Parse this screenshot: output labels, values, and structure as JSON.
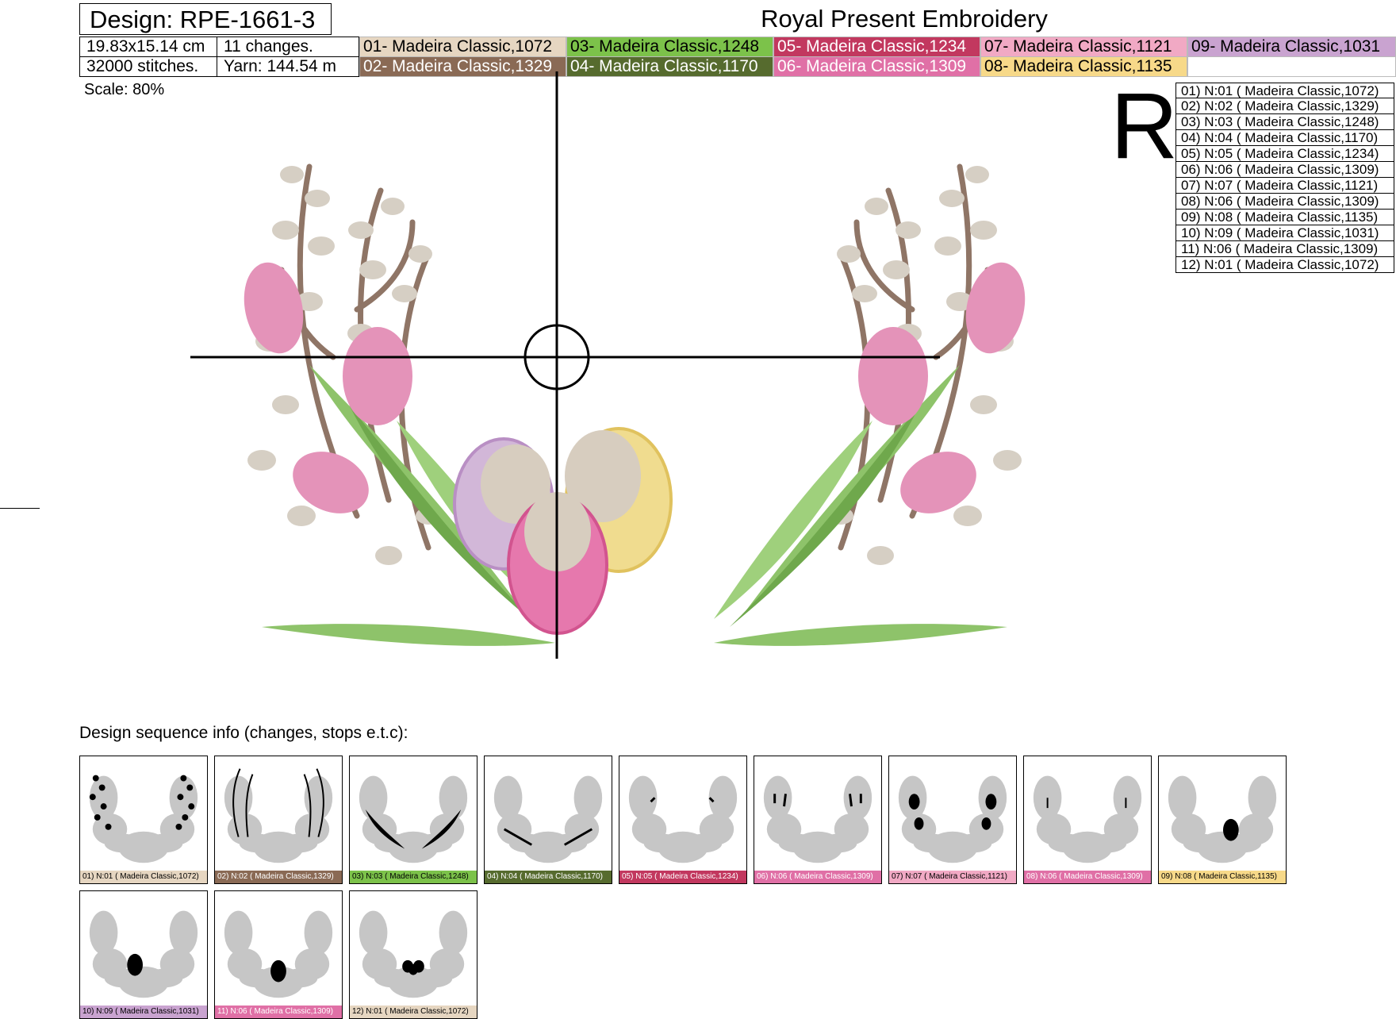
{
  "design_label": "Design: RPE-1661-3",
  "brand": "Royal Present Embroidery",
  "info": {
    "size": "19.83x15.14 cm",
    "changes": "11 changes.",
    "stitches": "32000 stitches.",
    "yarn": "Yarn: 144.54 m"
  },
  "threads": [
    {
      "label": "01- Madeira Classic,1072",
      "color": "#e6d6c1",
      "text_color": "#000000"
    },
    {
      "label": "02- Madeira Classic,1329",
      "color": "#8a6a55",
      "text_color": "#ffffff"
    },
    {
      "label": "03- Madeira Classic,1248",
      "color": "#7cc24a",
      "text_color": "#000000"
    },
    {
      "label": "04- Madeira Classic,1170",
      "color": "#566b2e",
      "text_color": "#ffffff"
    },
    {
      "label": "05- Madeira Classic,1234",
      "color": "#c2385f",
      "text_color": "#ffffff"
    },
    {
      "label": "06- Madeira Classic,1309",
      "color": "#e070a6",
      "text_color": "#ffffff"
    },
    {
      "label": "07- Madeira Classic,1121",
      "color": "#f1a9c4",
      "text_color": "#000000"
    },
    {
      "label": "08- Madeira Classic,1135",
      "color": "#f7d989",
      "text_color": "#000000"
    },
    {
      "label": "09- Madeira Classic,1031",
      "color": "#c9a3d0",
      "text_color": "#000000"
    }
  ],
  "scale": "Scale: 80%",
  "rotation_letter": "R",
  "stops": [
    "01) N:01 ( Madeira Classic,1072)",
    "02) N:02 ( Madeira Classic,1329)",
    "03) N:03 ( Madeira Classic,1248)",
    "04) N:04 ( Madeira Classic,1170)",
    "05) N:05 ( Madeira Classic,1234)",
    "06) N:06 ( Madeira Classic,1309)",
    "07) N:07 ( Madeira Classic,1121)",
    "08) N:06 ( Madeira Classic,1309)",
    "09) N:08 ( Madeira Classic,1135)",
    "10) N:09 ( Madeira Classic,1031)",
    "11) N:06 ( Madeira Classic,1309)",
    "12) N:01 ( Madeira Classic,1072)"
  ],
  "sequence_label": "Design sequence info (changes, stops e.t.c):",
  "thumbnails": [
    {
      "label": "01) N:01 ( Madeira Classic,1072)",
      "color": "#e6d6c1",
      "text_color": "#000000",
      "highlight": "catkins"
    },
    {
      "label": "02) N:02 ( Madeira Classic,1329)",
      "color": "#8a6a55",
      "text_color": "#ffffff",
      "highlight": "stems"
    },
    {
      "label": "03) N:03 ( Madeira Classic,1248)",
      "color": "#7cc24a",
      "text_color": "#000000",
      "highlight": "leaves"
    },
    {
      "label": "04) N:04 ( Madeira Classic,1170)",
      "color": "#566b2e",
      "text_color": "#ffffff",
      "highlight": "leaf-shadows"
    },
    {
      "label": "05) N:05 ( Madeira Classic,1234)",
      "color": "#c2385f",
      "text_color": "#ffffff",
      "highlight": "petal-lines"
    },
    {
      "label": "06) N:06 ( Madeira Classic,1309)",
      "color": "#e070a6",
      "text_color": "#ffffff",
      "highlight": "petal-outlines"
    },
    {
      "label": "07) N:07 ( Madeira Classic,1121)",
      "color": "#f1a9c4",
      "text_color": "#000000",
      "highlight": "petals"
    },
    {
      "label": "08) N:06 ( Madeira Classic,1309)",
      "color": "#e070a6",
      "text_color": "#ffffff",
      "highlight": "petal-details"
    },
    {
      "label": "09) N:08 ( Madeira Classic,1135)",
      "color": "#f7d989",
      "text_color": "#000000",
      "highlight": "egg-right"
    },
    {
      "label": "10) N:09 ( Madeira Classic,1031)",
      "color": "#c9a3d0",
      "text_color": "#000000",
      "highlight": "egg-left"
    },
    {
      "label": "11) N:06 ( Madeira Classic,1309)",
      "color": "#e070a6",
      "text_color": "#ffffff",
      "highlight": "egg-center"
    },
    {
      "label": "12) N:01 ( Madeira Classic,1072)",
      "color": "#e6d6c1",
      "text_color": "#000000",
      "highlight": "egg-tops"
    }
  ]
}
